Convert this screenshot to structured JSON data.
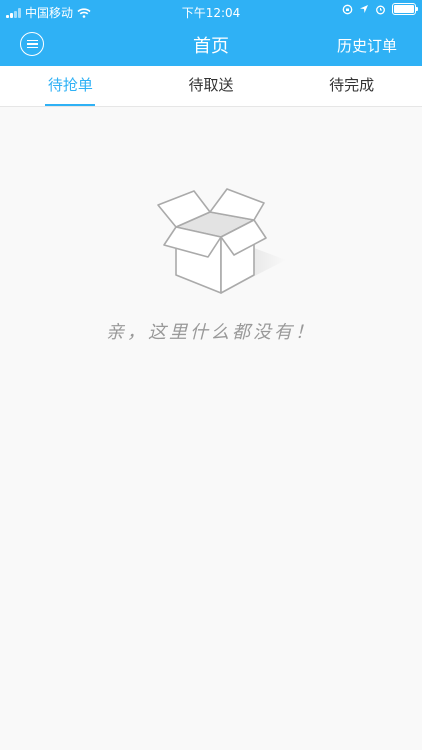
{
  "status_bar": {
    "carrier": "中国移动",
    "time": "下午12:04"
  },
  "header": {
    "title": "首页",
    "history_label": "历史订单"
  },
  "tabs": [
    {
      "label": "待抢单",
      "active": true
    },
    {
      "label": "待取送",
      "active": false
    },
    {
      "label": "待完成",
      "active": false
    }
  ],
  "empty_state": {
    "message": "亲，这里什么都没有！",
    "icon": "empty-box-icon"
  },
  "colors": {
    "brand": "#2fb1f5",
    "background": "#f9f9f9",
    "muted_text": "#999999"
  }
}
